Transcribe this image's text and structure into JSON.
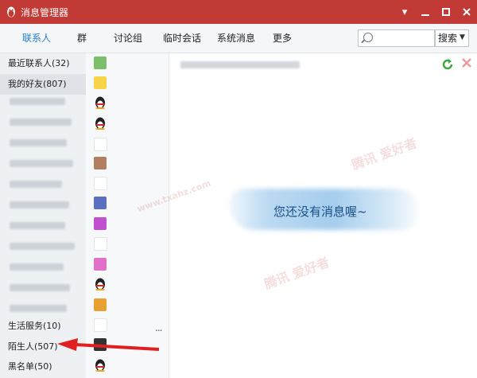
{
  "window": {
    "title": "消息管理器",
    "icon": "qq-penguin-icon",
    "controls": [
      "minimize-icon",
      "maximize-icon",
      "close-icon"
    ]
  },
  "tabs": [
    {
      "label": "联系人",
      "active": true
    },
    {
      "label": "群",
      "active": false
    },
    {
      "label": "讨论组",
      "active": false
    },
    {
      "label": "临时会话",
      "active": false
    },
    {
      "label": "系统消息",
      "active": false
    },
    {
      "label": "更多",
      "active": false
    }
  ],
  "search": {
    "placeholder": "",
    "button_label": "搜索"
  },
  "sidebar": {
    "categories": [
      {
        "label": "最近联系人(32)"
      },
      {
        "label": "我的好友(807)"
      },
      {
        "label": "生活服务(10)"
      },
      {
        "label": "陌生人(507)"
      },
      {
        "label": "黑名单(50)"
      }
    ],
    "more_label": "..."
  },
  "main": {
    "empty_message": "您还没有消息喔~"
  },
  "watermark": {
    "text": "腾讯 爱好者",
    "url": "www.txahz.com"
  },
  "colors": {
    "titlebar": "#c23a35",
    "active_tab": "#1e7fd0",
    "arrow": "#e02020"
  }
}
